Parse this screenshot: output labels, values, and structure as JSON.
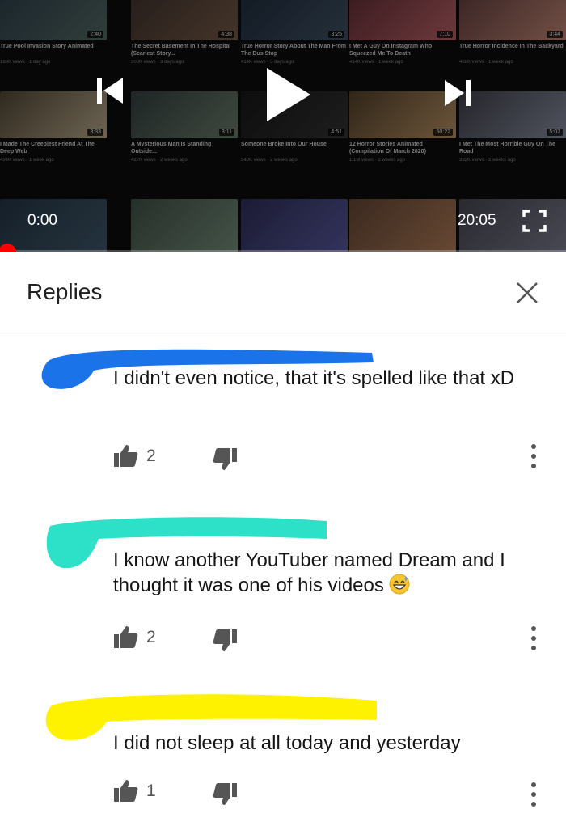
{
  "player": {
    "time_current": "0:00",
    "time_total": "20:05",
    "progress_fraction": 0,
    "accent_color": "#ff0000",
    "icons": {
      "prev": "skip-previous-icon",
      "play": "play-icon",
      "next": "skip-next-icon",
      "fullscreen": "fullscreen-icon"
    },
    "suggestions_row1": [
      {
        "title": "True Pool Invasion Story Animated",
        "meta": "193K views · 1 day ago",
        "duration": "2:40"
      },
      {
        "title": "The Secret Basement In The Hospital (Scariest Story...",
        "meta": "300K views · 3 days ago",
        "duration": "4:38"
      },
      {
        "title": "True Horror Story About The Man From The Bus Stop",
        "meta": "414K views · 5 days ago",
        "duration": "3:25"
      },
      {
        "title": "I Met A Guy On Instagram Who Squeezed Me To Death",
        "meta": "414K views · 1 week ago",
        "duration": "7:10"
      },
      {
        "title": "True Horror Incidence In The Backyard",
        "meta": "488K views · 1 week ago",
        "duration": "3:44"
      }
    ],
    "suggestions_row2": [
      {
        "title": "I Made The Creepiest Friend At The Deep Web",
        "meta": "424K views · 1 week ago",
        "duration": "3:33"
      },
      {
        "title": "A Mysterious Man Is Standing Outside...",
        "meta": "427K views · 2 weeks ago",
        "duration": "3:11"
      },
      {
        "title": "Someone Broke Into Our House",
        "meta": "340K views · 2 weeks ago",
        "duration": "4:51"
      },
      {
        "title": "12 Horror Stories Animated (Compilation Of March 2020)",
        "meta": "1.1M views · 2 weeks ago",
        "duration": "50:22"
      },
      {
        "title": "I Met The Most Horrible Guy On The Road",
        "meta": "392K views · 2 weeks ago",
        "duration": "5:07"
      }
    ]
  },
  "replies": {
    "title": "Replies",
    "close_icon": "close-icon",
    "items": [
      {
        "text": "I didn't even notice, that it's spelled like that xD",
        "likes": "2",
        "redaction_color": "#1a73e8"
      },
      {
        "text": "I know another YouTuber named Dream and I thought it was one of his videos",
        "emoji": "grinning-sweat-emoji",
        "likes": "2",
        "redaction_color": "#2de0c8"
      },
      {
        "text": "I did not sleep at all today and yesterday",
        "likes": "1",
        "redaction_color": "#fff200"
      }
    ],
    "icons": {
      "like": "thumbs-up-icon",
      "dislike": "thumbs-down-icon",
      "more": "more-vert-icon"
    }
  }
}
